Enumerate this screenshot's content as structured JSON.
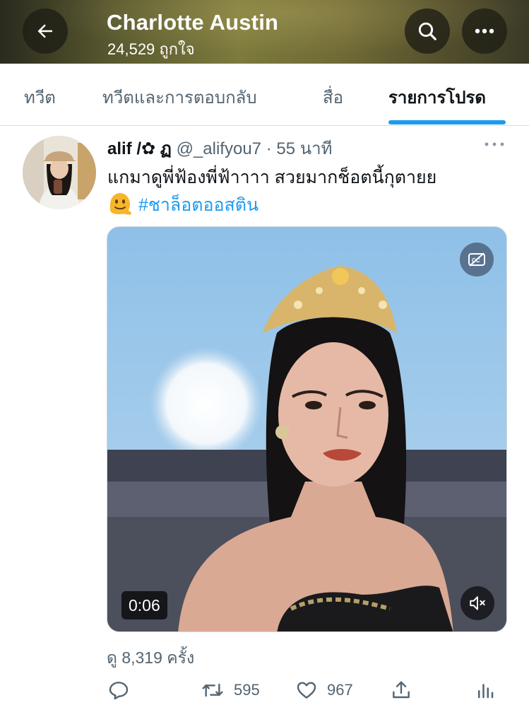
{
  "header": {
    "title": "Charlotte Austin",
    "subtitle": "24,529 ถูกใจ",
    "icons": {
      "back": "arrow-left-icon",
      "search": "search-icon",
      "more": "more-horizontal-icon"
    }
  },
  "tabs": [
    {
      "label": "ทวีต",
      "active": false
    },
    {
      "label": "ทวีตและการตอบกลับ",
      "active": false
    },
    {
      "label": "สื่อ",
      "active": false
    },
    {
      "label": "รายการโปรด",
      "active": true
    }
  ],
  "tweet": {
    "display_name": "alif /✿ ฏ",
    "handle": "@_alifyou7",
    "separator": "·",
    "time": "55 นาที",
    "text": "แกมาดูพี่ฟ้องพี่ฟ้าาาา สวยมากช็อตนี้กุตายย",
    "hashtag": "#ชาล็อตออสติน",
    "emoji": "melting-face-emoji",
    "media": {
      "duration": "0:06",
      "cc_icon": "closed-captions-off-icon",
      "mute_icon": "volume-muted-icon"
    },
    "views": "ดู 8,319 ครั้ง",
    "actions": {
      "reply_count": "",
      "retweet_count": "595",
      "like_count": "967"
    }
  },
  "colors": {
    "accent": "#1d9bf0",
    "text_primary": "#0f1419",
    "text_secondary": "#536471"
  }
}
